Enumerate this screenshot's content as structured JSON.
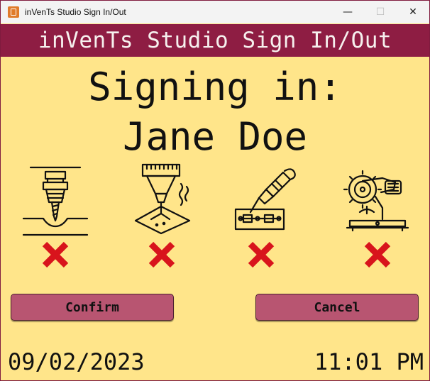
{
  "window": {
    "title": "inVenTs Studio Sign In/Out",
    "controls": {
      "minimize": "—",
      "maximize": "☐",
      "close": "✕"
    }
  },
  "header": {
    "title": "inVenTs Studio Sign In/Out"
  },
  "signing": {
    "label": "Signing in:",
    "name": "Jane Doe"
  },
  "tools": [
    {
      "icon": "drill-press-icon",
      "status": "not-authorized"
    },
    {
      "icon": "laser-cutter-icon",
      "status": "not-authorized"
    },
    {
      "icon": "soldering-iron-icon",
      "status": "not-authorized"
    },
    {
      "icon": "miter-saw-icon",
      "status": "not-authorized"
    }
  ],
  "buttons": {
    "confirm": "Confirm",
    "cancel": "Cancel"
  },
  "footer": {
    "date": "09/02/2023",
    "time": "11:01 PM"
  },
  "colors": {
    "background": "#ffe58a",
    "header": "#8e1d43",
    "button": "#b85571",
    "status_x": "#d8141c"
  }
}
